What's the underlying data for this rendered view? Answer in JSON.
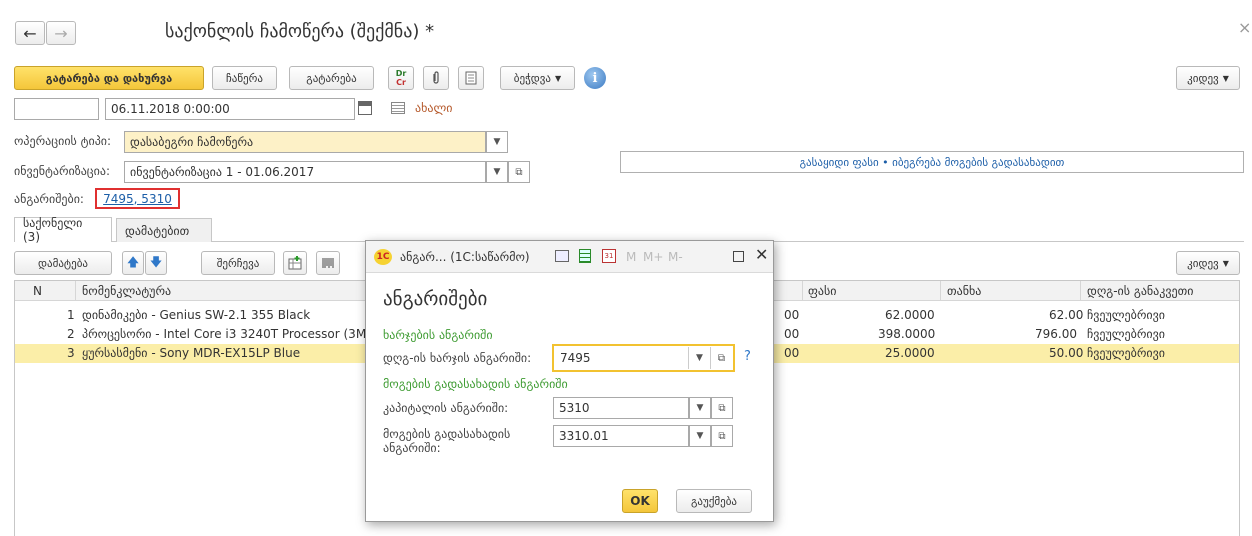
{
  "window": {
    "title": "საქონლის ჩამოწერა (შექმნა) *",
    "close_glyph": "×"
  },
  "nav": {
    "back_glyph": "←",
    "forward_glyph": "→"
  },
  "toolbar": {
    "post_close": "გატარება და დახურვა",
    "save": "ჩაწერა",
    "post": "გატარება",
    "drcr_top": "Dr",
    "drcr_bottom": "Cr",
    "print": "ბეჭდვა",
    "more": "კიდევ"
  },
  "header": {
    "number_value": "",
    "date_value": "06.11.2018 0:00:00",
    "status_link": "ახალი",
    "operation_label": "ოპერაციის ტიპი:",
    "operation_value": "დასაბეგრი ჩამოწერა",
    "inventory_label": "ინვენტარიზაცია:",
    "inventory_value": "ინვენტარიზაცია 1 - 01.06.2017",
    "accounts_label": "ანგარიშები:",
    "accounts_link": "7495, 5310",
    "price_link": "გასაყიდი ფასი • იბეგრება მოგების გადასახადით"
  },
  "tabs": [
    {
      "label": "საქონელი (3)"
    },
    {
      "label": "დამატებით"
    }
  ],
  "table_toolbar": {
    "add": "დამატება",
    "pick": "შერჩევა",
    "more": "კიდევ"
  },
  "table": {
    "columns": {
      "n": "N",
      "nomenclature": "ნომენკლატურა",
      "price": "ფასი",
      "amount": "თანხა",
      "vat": "დღგ-ის განაკვეთი"
    },
    "rows": [
      {
        "n": "1",
        "name": "დინამიკები - Genius SW-2.1 355 Black",
        "qty_tail": "00",
        "price": "62.0000",
        "amount": "62.00",
        "vat": "ჩვეულებრივი"
      },
      {
        "n": "2",
        "name": "პროცესორი - Intel Core i3 3240T Processor (3M C",
        "qty_tail": "00",
        "price": "398.0000",
        "amount": "796.00",
        "vat": "ჩვეულებრივი"
      },
      {
        "n": "3",
        "name": "ყურსასმენი - Sony MDR-EX15LP Blue",
        "qty_tail": "00",
        "price": "25.0000",
        "amount": "50.00",
        "vat": "ჩვეულებრივი"
      }
    ]
  },
  "dialog": {
    "title": "ანგარ... (1C:საწარმო)",
    "m_labels": [
      "M",
      "M+",
      "M-"
    ],
    "heading": "ანგარიშები",
    "section1": "ხარჯების ანგარიში",
    "vat_exp_label": "დღგ-ის ხარჯის ანგარიში:",
    "vat_exp_value": "7495",
    "help_glyph": "?",
    "section2": "მოგების გადასახადის ანგარიში",
    "capital_label": "კაპიტალის ანგარიში:",
    "capital_value": "5310",
    "profit_tax_label_1": "მოგების გადასახადის",
    "profit_tax_label_2": "ანგარიში:",
    "profit_tax_value": "3310.01",
    "ok": "OK",
    "cancel": "გაუქმება"
  },
  "colors": {
    "accent_yellow": "#f4c63a",
    "selected_row": "#fbeea8",
    "link_blue": "#1c5ea8",
    "section_green": "#3f9c33",
    "accounts_box_red": "#e03030"
  }
}
